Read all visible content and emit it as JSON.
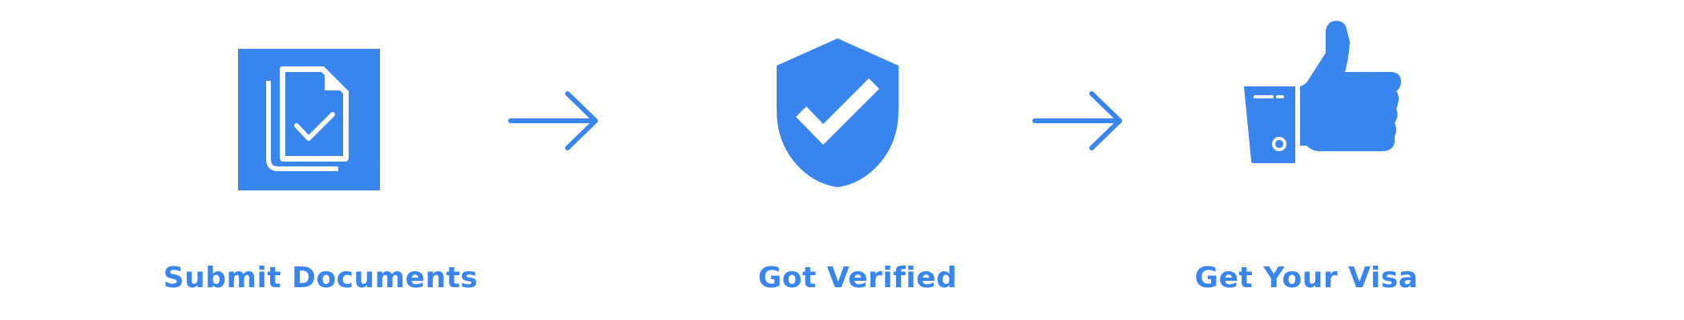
{
  "colors": {
    "accent": "#3985EF",
    "background": "#FFFFFF"
  },
  "steps": [
    {
      "label": "Submit Documents",
      "icon": "documents-check-icon"
    },
    {
      "label": "Got Verified",
      "icon": "shield-check-icon"
    },
    {
      "label": "Get Your Visa",
      "icon": "thumbs-up-icon"
    }
  ],
  "connectors": [
    {
      "icon": "arrow-right-icon"
    },
    {
      "icon": "arrow-right-icon"
    }
  ]
}
